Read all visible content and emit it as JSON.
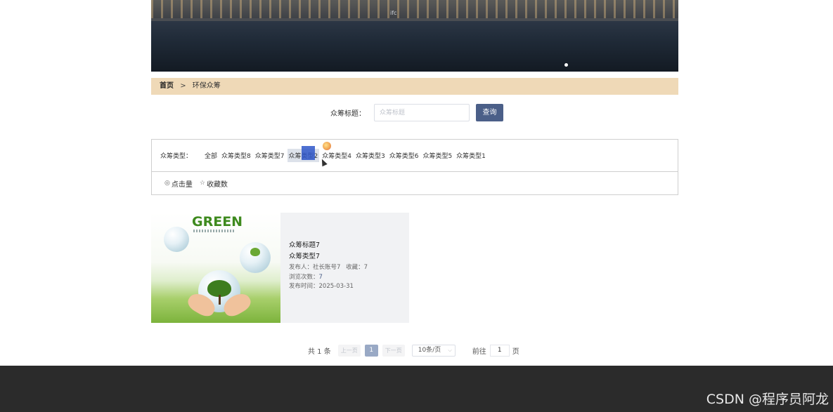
{
  "banner": {
    "label": "ifc"
  },
  "breadcrumb": {
    "home": "首页",
    "separator": ">",
    "current": "环保众筹"
  },
  "search": {
    "label": "众筹标题：",
    "placeholder": "众筹标题",
    "value": "",
    "button": "查询"
  },
  "filter": {
    "title": "众筹类型：",
    "options": [
      "全部",
      "众筹类型8",
      "众筹类型7",
      "众筹类型2",
      "众筹类型4",
      "众筹类型3",
      "众筹类型6",
      "众筹类型5",
      "众筹类型1"
    ],
    "selected": "众筹类型2",
    "sorts": [
      "点击量",
      "收藏数"
    ]
  },
  "card": {
    "image_text": "GREEN",
    "title": "众筹标题7",
    "type": "众筹类型7",
    "publisher_label": "发布人：",
    "publisher": "社长账号7",
    "favorites_label": "收藏：",
    "favorites": "7",
    "views_label": "浏览次数：",
    "views": "7",
    "date_label": "发布时间：",
    "date": "2025-03-31"
  },
  "pagination": {
    "total": "共 1 条",
    "prev": "上一页",
    "current": "1",
    "next": "下一页",
    "page_size": "10条/页",
    "goto_label": "前往",
    "goto_value": "1",
    "goto_suffix": "页"
  },
  "watermark": "CSDN @程序员阿龙",
  "colors": {
    "accent": "#4b5f88",
    "breadcrumb_bg": "#efd9b7",
    "footer": "#2b2b2b"
  }
}
